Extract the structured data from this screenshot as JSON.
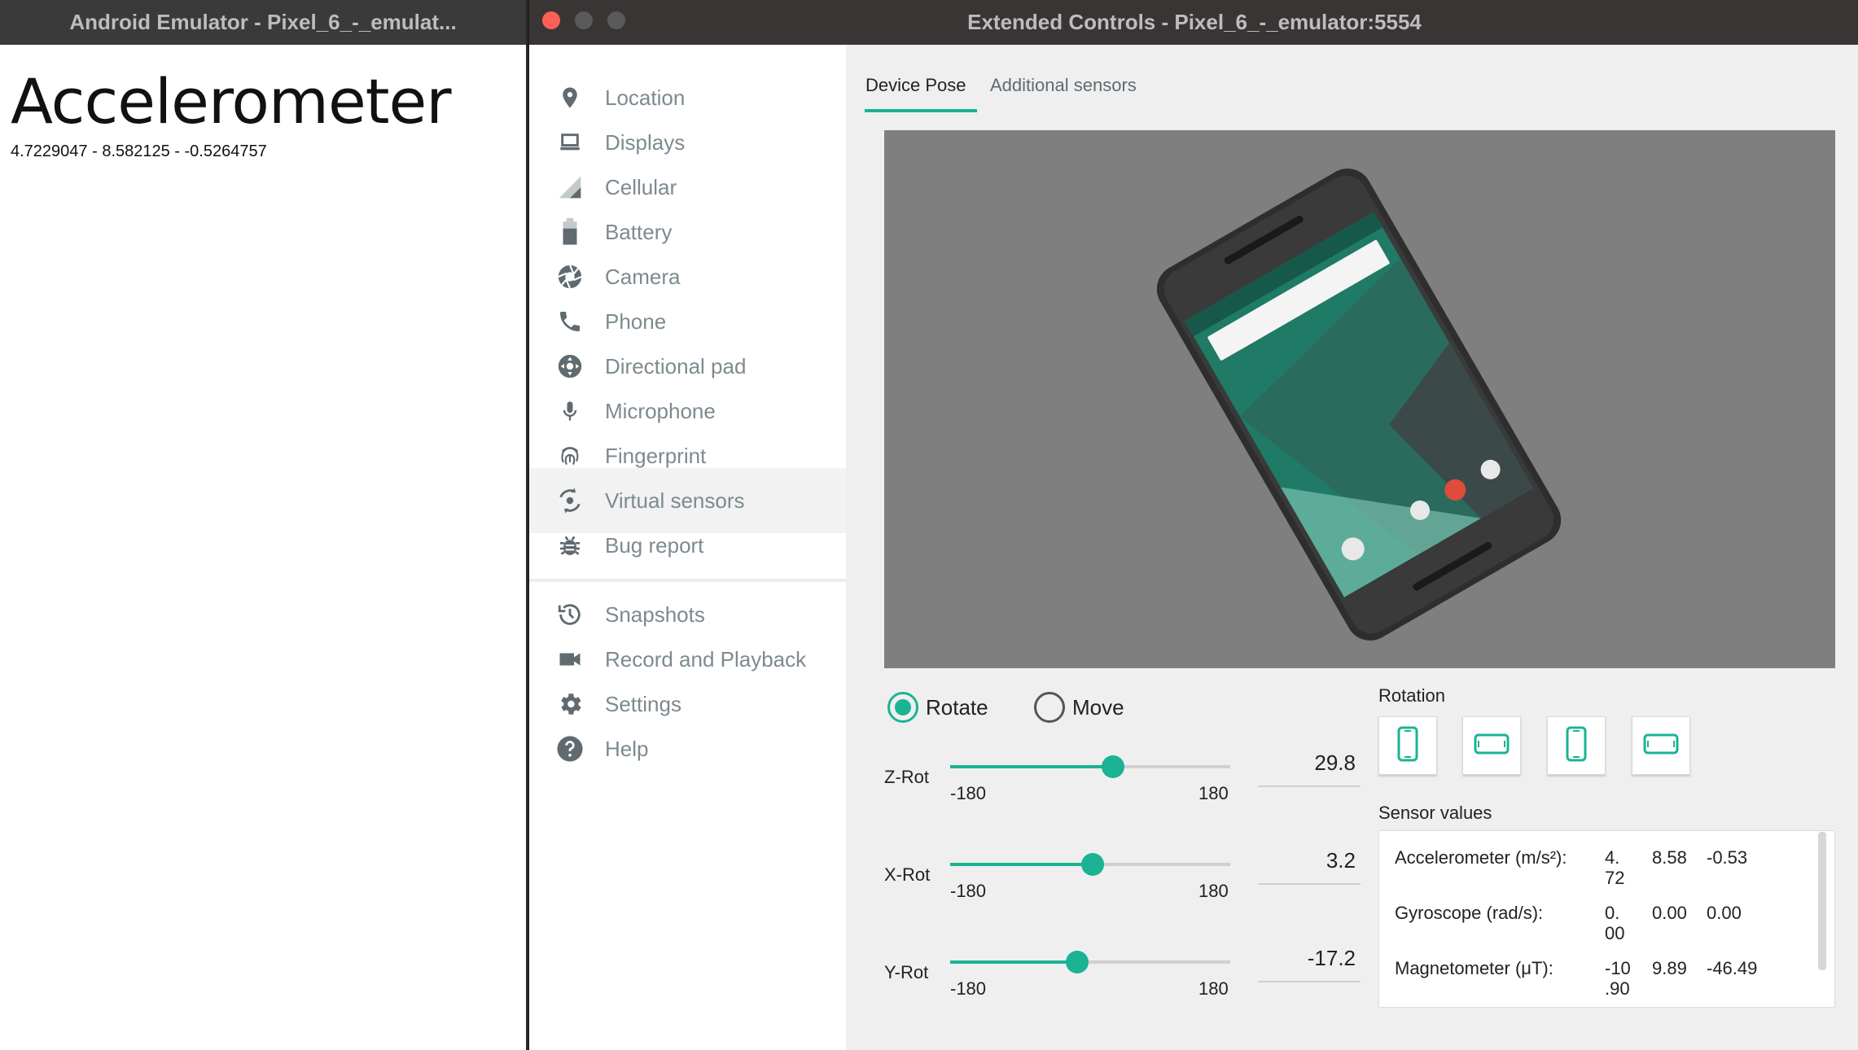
{
  "emulator_window": {
    "title": "Android Emulator - Pixel_6_-_emulat...",
    "app_title": "Accelerometer",
    "app_values": "4.7229047 - 8.582125 - -0.5264757"
  },
  "extended_window": {
    "title": "Extended Controls - Pixel_6_-_emulator:5554"
  },
  "sidebar": {
    "items": [
      {
        "label": "Location",
        "icon": "location-pin-icon"
      },
      {
        "label": "Displays",
        "icon": "display-icon"
      },
      {
        "label": "Cellular",
        "icon": "signal-icon"
      },
      {
        "label": "Battery",
        "icon": "battery-icon"
      },
      {
        "label": "Camera",
        "icon": "camera-aperture-icon"
      },
      {
        "label": "Phone",
        "icon": "phone-icon"
      },
      {
        "label": "Directional pad",
        "icon": "dpad-icon"
      },
      {
        "label": "Microphone",
        "icon": "microphone-icon"
      },
      {
        "label": "Fingerprint",
        "icon": "fingerprint-icon"
      },
      {
        "label": "Virtual sensors",
        "icon": "virtual-sensors-icon",
        "selected": true
      },
      {
        "label": "Bug report",
        "icon": "bug-icon"
      },
      {
        "label": "Snapshots",
        "icon": "history-icon"
      },
      {
        "label": "Record and Playback",
        "icon": "video-camera-icon"
      },
      {
        "label": "Settings",
        "icon": "gear-icon"
      },
      {
        "label": "Help",
        "icon": "help-icon"
      }
    ]
  },
  "tabs": [
    {
      "label": "Device Pose",
      "active": true
    },
    {
      "label": "Additional sensors",
      "active": false
    }
  ],
  "mode": {
    "rotate_label": "Rotate",
    "move_label": "Move",
    "selected": "Rotate"
  },
  "sliders": [
    {
      "label": "Z-Rot",
      "min": "-180",
      "max": "180",
      "value": "29.8",
      "numeric": 29.8
    },
    {
      "label": "X-Rot",
      "min": "-180",
      "max": "180",
      "value": "3.2",
      "numeric": 3.2
    },
    {
      "label": "Y-Rot",
      "min": "-180",
      "max": "180",
      "value": "-17.2",
      "numeric": -17.2
    }
  ],
  "rotation": {
    "title": "Rotation",
    "buttons": [
      "portrait-icon",
      "landscape-icon",
      "reverse-portrait-icon",
      "reverse-landscape-icon"
    ]
  },
  "sensor_values": {
    "title": "Sensor values",
    "rows": [
      {
        "name": "Accelerometer (m/s²):",
        "v1a": "4.",
        "v1b": "72",
        "v2": "8.58",
        "v3": "-0.53"
      },
      {
        "name": "Gyroscope (rad/s):",
        "v1a": "0.",
        "v1b": "00",
        "v2": "0.00",
        "v3": "0.00"
      },
      {
        "name": "Magnetometer (μT):",
        "v1a": "-10",
        "v1b": ".90",
        "v2": "9.89",
        "v3": "-46.49"
      }
    ]
  },
  "colors": {
    "accent": "#1ab394",
    "close_button": "#fe5f57",
    "viewport_bg": "#7f7f7f"
  }
}
